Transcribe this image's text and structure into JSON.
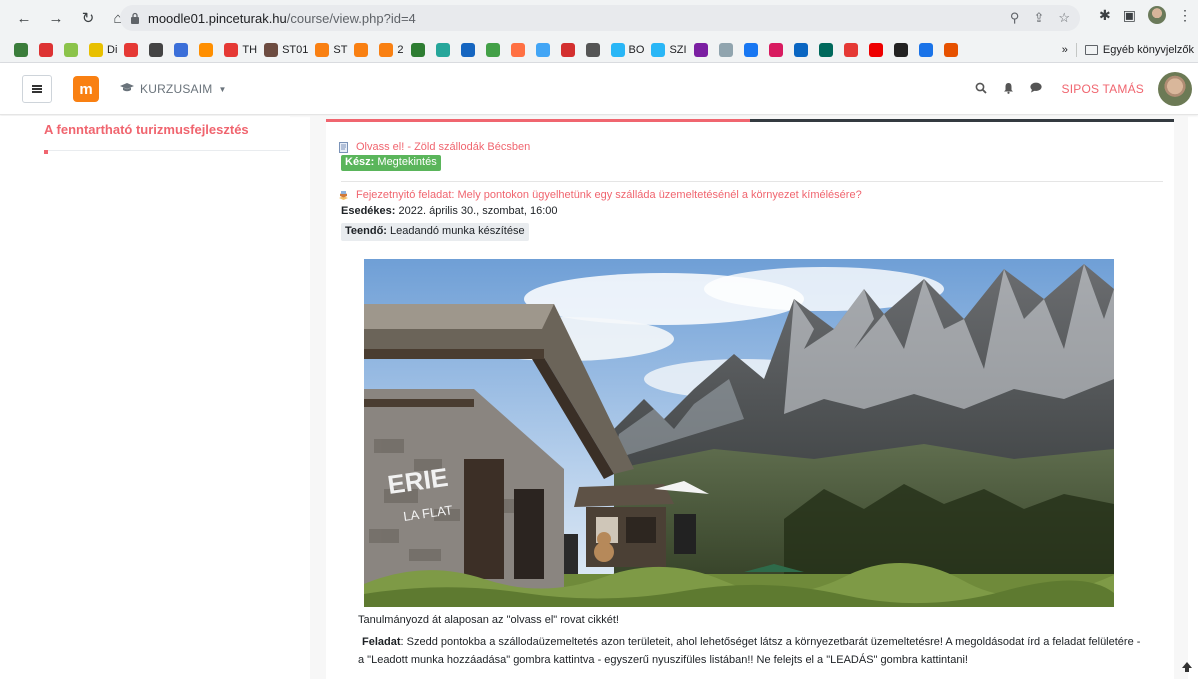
{
  "browser": {
    "url_host": "moodle01.pinceturak.hu",
    "url_path": "/course/view.php?id=4",
    "bookmarks": [
      {
        "label": "",
        "color": "#3b7d3b"
      },
      {
        "label": "",
        "color": "#d33"
      },
      {
        "label": "",
        "color": "#8bc34a"
      },
      {
        "label": "Di",
        "color": "#e8c000"
      },
      {
        "label": "",
        "color": "#e53935"
      },
      {
        "label": "",
        "color": "#444"
      },
      {
        "label": "",
        "color": "#3b6fd9"
      },
      {
        "label": "",
        "color": "#ff8f00"
      },
      {
        "label": "TH",
        "color": "#e53935"
      },
      {
        "label": "ST01",
        "color": "#6d4c41"
      },
      {
        "label": "ST",
        "color": "#f98012"
      },
      {
        "label": "",
        "color": "#f98012"
      },
      {
        "label": "2",
        "color": "#f98012"
      },
      {
        "label": "",
        "color": "#2e7d32"
      },
      {
        "label": "",
        "color": "#26a69a"
      },
      {
        "label": "",
        "color": "#1565c0"
      },
      {
        "label": "",
        "color": "#43a047"
      },
      {
        "label": "",
        "color": "#ff7043"
      },
      {
        "label": "",
        "color": "#42a5f5"
      },
      {
        "label": "",
        "color": "#d32f2f"
      },
      {
        "label": "",
        "color": "#555"
      },
      {
        "label": "BO",
        "color": "#29b6f6"
      },
      {
        "label": "SZI",
        "color": "#29b6f6"
      },
      {
        "label": "",
        "color": "#7b1fa2"
      },
      {
        "label": "",
        "color": "#90a4ae"
      },
      {
        "label": "",
        "color": "#1877f2"
      },
      {
        "label": "",
        "color": "#d81b60"
      },
      {
        "label": "",
        "color": "#0a66c2"
      },
      {
        "label": "",
        "color": "#00695c"
      },
      {
        "label": "",
        "color": "#e53935"
      },
      {
        "label": "",
        "color": "#e00"
      },
      {
        "label": "",
        "color": "#222"
      },
      {
        "label": "",
        "color": "#1a73e8"
      },
      {
        "label": "",
        "color": "#e65100"
      }
    ],
    "bookmarks_overflow": "»",
    "other_bookmarks": "Egyéb könyvjelzők"
  },
  "header": {
    "menu_label": "KURZUSAIM",
    "logo_letter": "m",
    "user_name": "SIPOS TAMÁS"
  },
  "sidebar": {
    "course_title": "A fenntartható turizmusfejlesztés"
  },
  "main": {
    "activity1": {
      "link": "Olvass el! - Zöld szállodák Bécsben",
      "done_label": "Kész:",
      "done_value": "Megtekintés"
    },
    "activity2": {
      "link": "Fejezetnyitó feladat: Mely pontokon ügyelhetünk egy szálláda üzemeltetésénél a környezet kímélésére?",
      "due_label": "Esedékes:",
      "due_value": "2022. április 30., szombat, 16:00",
      "todo_label": "Teendő:",
      "todo_value": "Leadandó munka készítése"
    },
    "sign_text_1": "ERIE",
    "sign_text_2": "LA FLAT",
    "paragraph1": "Tanulmányozd át alaposan az \"olvass el\" rovat cikkét!",
    "task_label": "Feladat",
    "task_line1": ": Szedd pontokba a szállodaüzemeltetés azon területeit, ahol lehetőséget látsz a környezetbarát üzemeltetésre! A megoldásodat írd a  feladat felületére -",
    "task_line2": "a \"Leadott munka hozzáadása\" gombra kattintva - egyszerű nyuszifüles listában!! Ne felejts el a \"LEADÁS\" gombra kattintani!"
  },
  "colors": {
    "accent": "#f0656f",
    "done_badge": "#5ab55b",
    "moodle_orange": "#f98012"
  }
}
